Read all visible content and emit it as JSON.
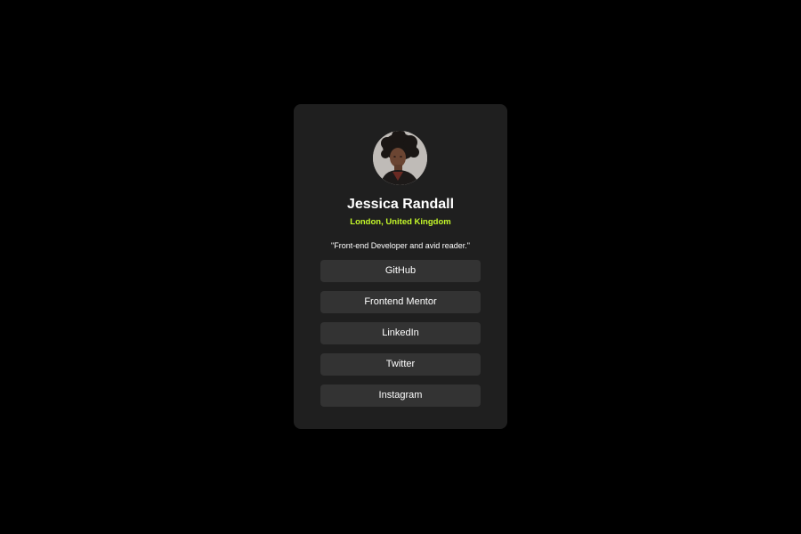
{
  "profile": {
    "name": "Jessica Randall",
    "location": "London, United Kingdom",
    "bio": "\"Front-end Developer and avid reader.\""
  },
  "links": [
    {
      "label": "GitHub"
    },
    {
      "label": "Frontend Mentor"
    },
    {
      "label": "LinkedIn"
    },
    {
      "label": "Twitter"
    },
    {
      "label": "Instagram"
    }
  ],
  "colors": {
    "background": "#000000",
    "card": "#1f1f1f",
    "button": "#333333",
    "accent": "#c4f82a",
    "text": "#ffffff"
  }
}
